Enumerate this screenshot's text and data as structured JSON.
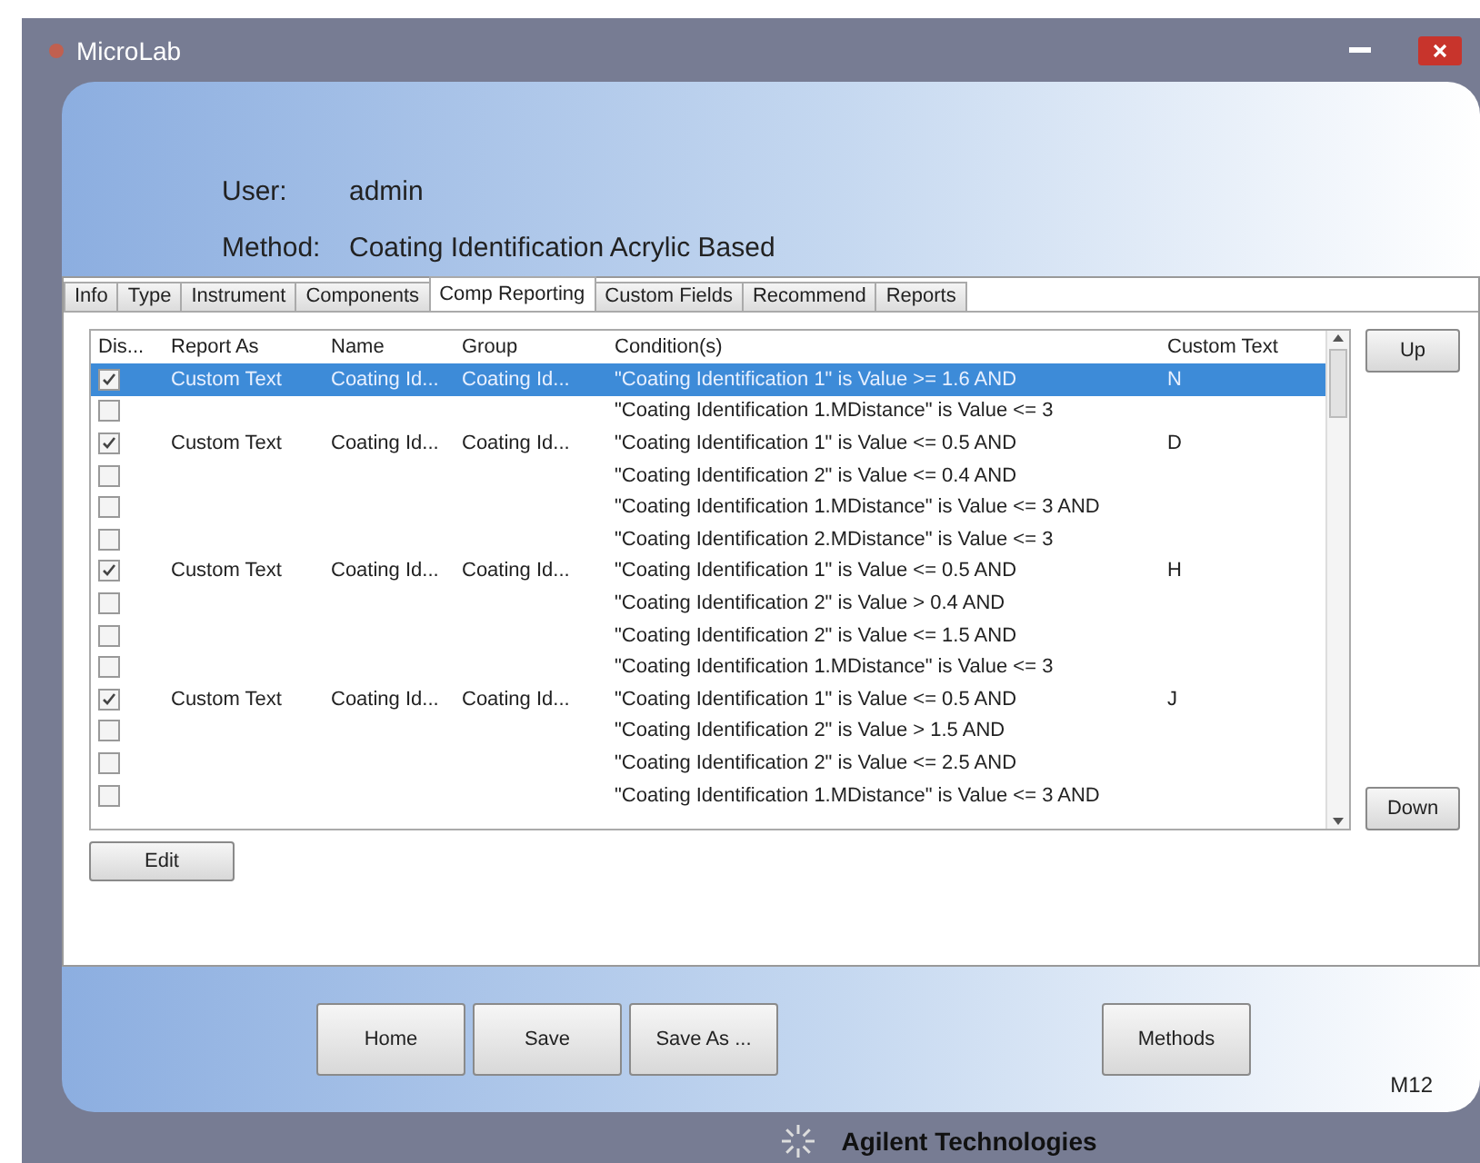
{
  "window": {
    "title": "MicroLab"
  },
  "header": {
    "user_label": "User:",
    "user": "admin",
    "method_label": "Method:",
    "method": "Coating Identification Acrylic Based"
  },
  "tabs": [
    {
      "label": "Info",
      "selected": false
    },
    {
      "label": "Type",
      "selected": false
    },
    {
      "label": "Instrument",
      "selected": false
    },
    {
      "label": "Components",
      "selected": false
    },
    {
      "label": "Comp Reporting",
      "selected": true
    },
    {
      "label": "Custom Fields",
      "selected": false
    },
    {
      "label": "Recommend",
      "selected": false
    },
    {
      "label": "Reports",
      "selected": false
    }
  ],
  "table": {
    "columns": [
      "Dis...",
      "Report As",
      "Name",
      "Group",
      "Condition(s)",
      "Custom Text"
    ],
    "rows": [
      {
        "checked": true,
        "selected": true,
        "report_as": "Custom Text",
        "name": "Coating Id...",
        "group": "Coating Id...",
        "condition": "\"Coating Identification 1\" is Value >= 1.6 AND",
        "custom_text": "N"
      },
      {
        "checked": false,
        "selected": false,
        "condition": "\"Coating Identification 1.MDistance\" is Value <= 3"
      },
      {
        "checked": true,
        "selected": false,
        "report_as": "Custom Text",
        "name": "Coating Id...",
        "group": "Coating Id...",
        "condition": "\"Coating Identification 1\" is Value <= 0.5 AND",
        "custom_text": "D"
      },
      {
        "checked": false,
        "selected": false,
        "condition": "\"Coating Identification 2\" is Value <= 0.4 AND"
      },
      {
        "checked": false,
        "selected": false,
        "condition": "\"Coating Identification 1.MDistance\" is Value <= 3 AND"
      },
      {
        "checked": false,
        "selected": false,
        "condition": "\"Coating Identification 2.MDistance\" is Value <= 3"
      },
      {
        "checked": true,
        "selected": false,
        "report_as": "Custom Text",
        "name": "Coating Id...",
        "group": "Coating Id...",
        "condition": "\"Coating Identification 1\" is Value <= 0.5 AND",
        "custom_text": "H"
      },
      {
        "checked": false,
        "selected": false,
        "condition": "\"Coating Identification 2\" is Value > 0.4 AND"
      },
      {
        "checked": false,
        "selected": false,
        "condition": "\"Coating Identification 2\" is Value <= 1.5 AND"
      },
      {
        "checked": false,
        "selected": false,
        "condition": "\"Coating Identification 1.MDistance\" is Value <= 3"
      },
      {
        "checked": true,
        "selected": false,
        "report_as": "Custom Text",
        "name": "Coating Id...",
        "group": "Coating Id...",
        "condition": "\"Coating Identification 1\" is Value <= 0.5 AND",
        "custom_text": "J"
      },
      {
        "checked": false,
        "selected": false,
        "condition": "\"Coating Identification 2\" is Value > 1.5 AND"
      },
      {
        "checked": false,
        "selected": false,
        "condition": "\"Coating Identification 2\" is Value <= 2.5 AND"
      },
      {
        "checked": false,
        "selected": false,
        "condition": "\"Coating Identification 1.MDistance\" is Value <= 3 AND"
      }
    ]
  },
  "side_buttons": [
    "Up",
    "Down"
  ],
  "edit_button": "Edit",
  "footer_buttons": [
    "Home",
    "Save",
    "Save As ..."
  ],
  "methods_button": "Methods",
  "screen_code": "M12",
  "brand": "Agilent Technologies"
}
